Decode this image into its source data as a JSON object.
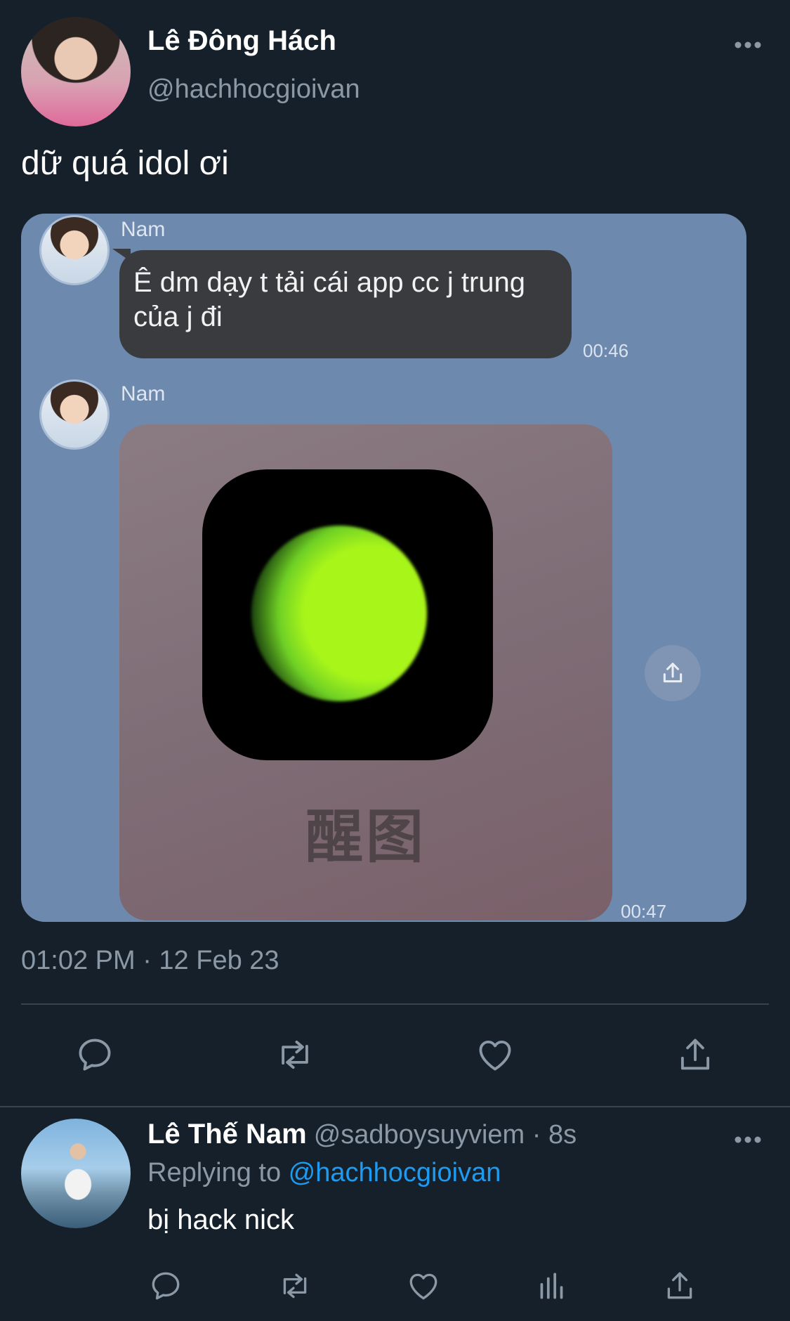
{
  "tweet": {
    "author_name": "Lê Đông Hách",
    "author_handle": "@hachhocgioivan",
    "text": "dữ quá idol ơi",
    "timestamp": "01:02 PM · 12 Feb 23"
  },
  "chat": {
    "sender_name_1": "Nam",
    "message_1": "Ê dm dạy t tải cái app cc j trung của j đi",
    "time_1": "00:46",
    "sender_name_2": "Nam",
    "app_label": "醒图",
    "time_2": "00:47"
  },
  "reply": {
    "author_name": "Lê Thế Nam",
    "meta": "@sadboysuyviem · 8s",
    "replying_prefix": "Replying to ",
    "replying_handle": "@hachhocgioivan",
    "text": "bị hack nick"
  },
  "icons": {
    "more": "more-horizontal-icon",
    "reply": "reply-icon",
    "retweet": "retweet-icon",
    "like": "heart-icon",
    "share": "share-icon",
    "analytics": "analytics-icon"
  },
  "colors": {
    "background": "#15202b",
    "muted_text": "#8b98a5",
    "link": "#1d9bf0",
    "chat_background": "#6d89ad",
    "chat_bubble": "#3a3b3f",
    "app_glow": "#a8f51a"
  }
}
